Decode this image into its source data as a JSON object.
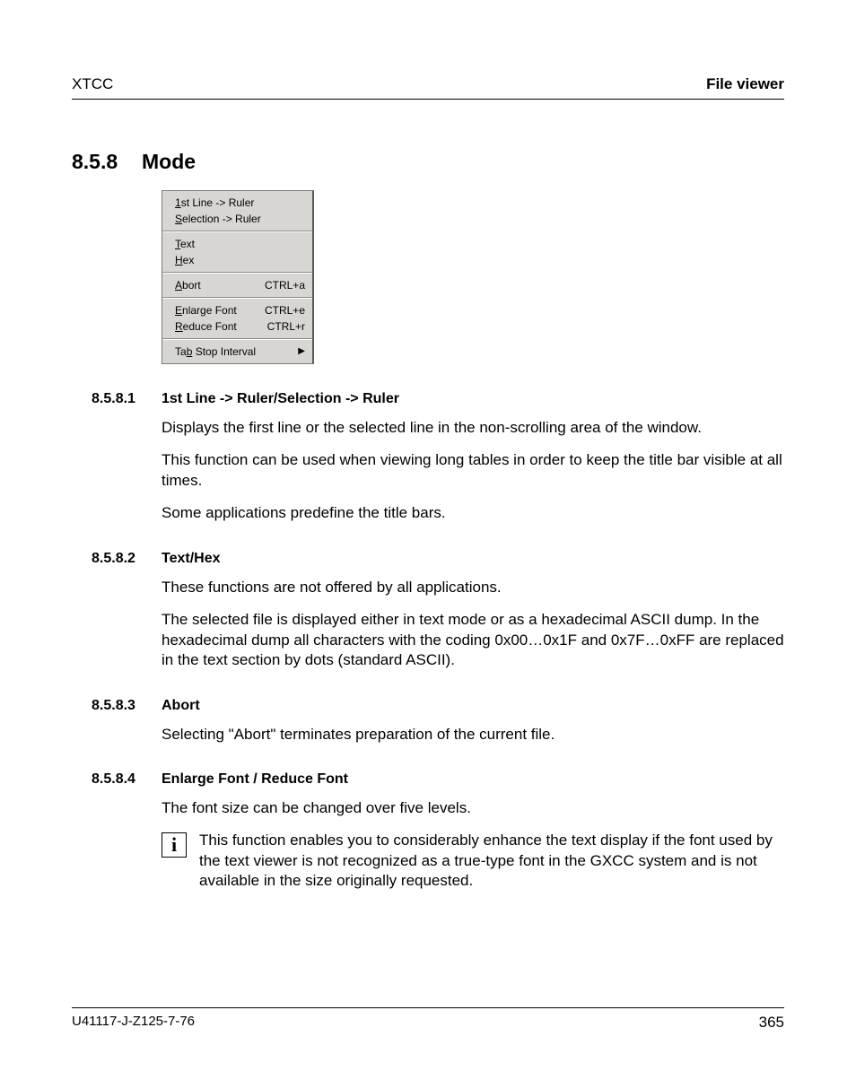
{
  "header": {
    "left": "XTCC",
    "right": "File viewer"
  },
  "section": {
    "num": "8.5.8",
    "title": "Mode"
  },
  "menu": {
    "g1": [
      {
        "pre": "",
        "u": "1",
        "post": "st Line -> Ruler"
      },
      {
        "pre": "",
        "u": "S",
        "post": "election -> Ruler"
      }
    ],
    "g2": [
      {
        "pre": "",
        "u": "T",
        "post": "ext"
      },
      {
        "pre": "",
        "u": "H",
        "post": "ex"
      }
    ],
    "g3": [
      {
        "pre": "",
        "u": "A",
        "post": "bort",
        "sc": "CTRL+a"
      }
    ],
    "g4": [
      {
        "pre": "",
        "u": "E",
        "post": "nlarge Font",
        "sc": "CTRL+e"
      },
      {
        "pre": "",
        "u": "R",
        "post": "educe Font",
        "sc": "CTRL+r"
      }
    ],
    "g5": [
      {
        "pre": "Ta",
        "u": "b",
        "post": " Stop Interval",
        "arrow": true
      }
    ]
  },
  "s1": {
    "num": "8.5.8.1",
    "title": "1st Line -> Ruler/Selection -> Ruler",
    "p1": "Displays the first line or the selected line in the non-scrolling area of the window.",
    "p2": "This function can be used when viewing long tables in order to keep the title bar visible at all times.",
    "p3": "Some applications predefine the title bars."
  },
  "s2": {
    "num": "8.5.8.2",
    "title": "Text/Hex",
    "p1": "These functions are not offered by all applications.",
    "p2": "The selected file is displayed either in text mode or as a hexadecimal ASCII dump. In the hexadecimal dump all characters with the coding 0x00…0x1F and 0x7F…0xFF are replaced in the text section by dots (standard ASCII)."
  },
  "s3": {
    "num": "8.5.8.3",
    "title": "Abort",
    "p1": "Selecting \"Abort\" terminates preparation of the current file."
  },
  "s4": {
    "num": "8.5.8.4",
    "title": "Enlarge Font / Reduce Font",
    "p1": "The font size can be changed over five levels.",
    "note_icon": "i",
    "note": "This function enables you to considerably enhance the text display if the font used by the text viewer is not recognized as a true-type font in the GXCC system and is not available in the size originally requested."
  },
  "footer": {
    "left": "U41117-J-Z125-7-76",
    "right": "365"
  }
}
